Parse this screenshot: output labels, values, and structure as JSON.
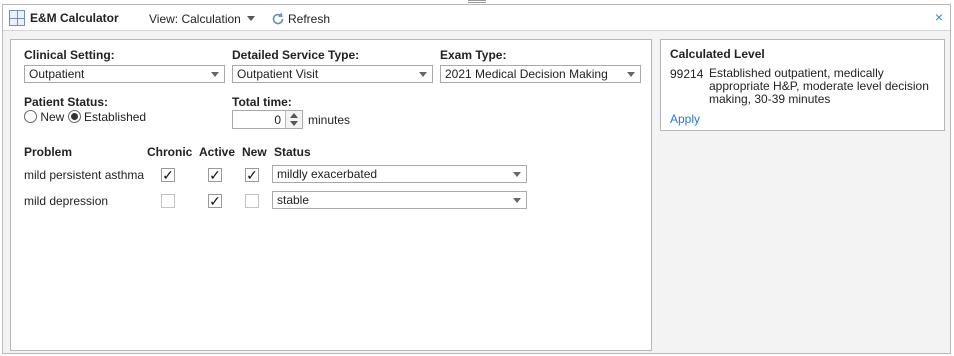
{
  "window": {
    "title": "E&M Calculator",
    "view_label": "View: Calculation",
    "refresh_label": "Refresh",
    "close_glyph": "×"
  },
  "form": {
    "clinical_setting": {
      "label": "Clinical Setting:",
      "value": "Outpatient"
    },
    "service_type": {
      "label": "Detailed Service Type:",
      "value": "Outpatient Visit"
    },
    "exam_type": {
      "label": "Exam Type:",
      "value": "2021 Medical Decision Making"
    },
    "patient_status": {
      "label": "Patient Status:",
      "options": [
        "New",
        "Established"
      ],
      "selected": "Established"
    },
    "total_time": {
      "label": "Total time:",
      "value": "0",
      "unit": "minutes"
    }
  },
  "problems": {
    "headers": {
      "problem": "Problem",
      "chronic": "Chronic",
      "active": "Active",
      "new": "New",
      "status": "Status"
    },
    "rows": [
      {
        "problem": "mild persistent asthma",
        "chronic": true,
        "active": true,
        "new": true,
        "status": "mildly exacerbated"
      },
      {
        "problem": "mild depression",
        "chronic": false,
        "active": true,
        "new": false,
        "status": "stable"
      }
    ]
  },
  "result": {
    "title": "Calculated Level",
    "code": "99214",
    "description": "Established outpatient, medically appropriate H&P, moderate level decision making, 30-39 minutes",
    "apply_label": "Apply"
  },
  "colors": {
    "accent_link": "#2a7bc8",
    "close_icon": "#2a8ad4",
    "window_bg": "#f3f3f3"
  },
  "icons": {
    "app": "calculator-icon",
    "refresh": "refresh-icon",
    "close": "close-icon",
    "dropdown": "chevron-down-icon",
    "checkbox": "check-icon"
  }
}
